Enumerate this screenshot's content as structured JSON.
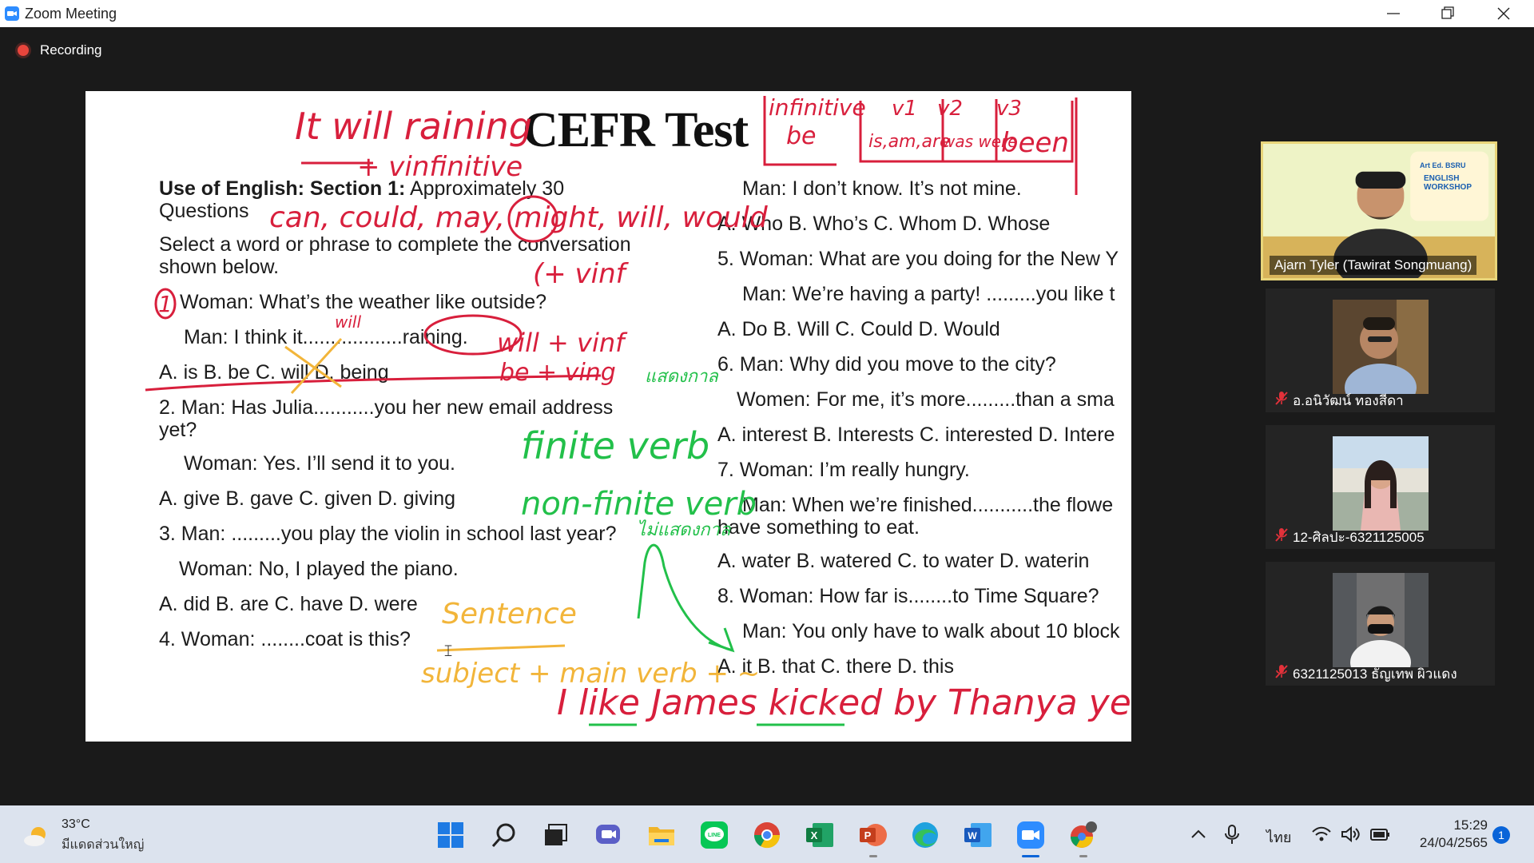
{
  "window": {
    "title": "Zoom Meeting"
  },
  "recording": {
    "label": "Recording"
  },
  "slide": {
    "title": "CEFR Test",
    "left_column": [
      {
        "text": "Use of English: Section 1: Approximately 30",
        "bold_prefix": "Use of English: Section 1:",
        "rest": " Approximately 30"
      },
      {
        "text": "Questions"
      },
      {
        "text": "Select a word or phrase to complete the conversation"
      },
      {
        "text": "shown below."
      },
      {
        "text": "Woman: What’s the weather like outside?"
      },
      {
        "text": "Man: I think it..................raining."
      },
      {
        "text": "A. is  B. be C. will  D. being"
      },
      {
        "text": "2. Man: Has Julia...........you her new email address"
      },
      {
        "text": "yet?"
      },
      {
        "text": "Woman: Yes. I’ll send it to you."
      },
      {
        "text": "A. give  B. gave   C. given   D. giving"
      },
      {
        "text": "3. Man: .........you play the violin in school last year?"
      },
      {
        "text": "Woman: No, I played the piano."
      },
      {
        "text": "A. did  B. are  C. have  D. were"
      },
      {
        "text": "4. Woman: ........coat is this?"
      }
    ],
    "right_column": [
      {
        "text": "Man: I don’t know. It’s not mine."
      },
      {
        "text": "A. Who  B. Who’s   C. Whom  D. Whose"
      },
      {
        "text": "5. Woman: What are you doing for the New Y"
      },
      {
        "text": "Man: We’re having a party! .........you like t"
      },
      {
        "text": "A. Do   B. Will  C. Could   D. Would"
      },
      {
        "text": "6. Man: Why did you move to the city?"
      },
      {
        "text": "Women: For me, it’s more.........than a sma"
      },
      {
        "text": "A. interest   B. Interests  C. interested D. Intere"
      },
      {
        "text": "7. Woman: I’m really hungry."
      },
      {
        "text": "Man: When we’re finished...........the flowe"
      },
      {
        "text": "have something to eat."
      },
      {
        "text": "A. water      B. watered    C. to water  D. waterin"
      },
      {
        "text": "8. Woman: How far is........to Time Square?"
      },
      {
        "text": "Man: You only have to walk about 10 block"
      },
      {
        "text": "A. it     B. that    C. there   D. this"
      }
    ],
    "annotations": {
      "top_left": "It will raining",
      "top_left_sub": "+ vinfinitive",
      "modals": "can, could, may, might, will, would",
      "plus_vinf": "(+ vinf",
      "question_number": "1",
      "above_blank": "will",
      "will_vinf": "will + vinf",
      "be_ving": "be + ving",
      "finite": "finite verb",
      "nonfinite": "non-finite verb",
      "nonfinite_thai": "ไม่แสดงกาล",
      "thai_small": "แสดงกาล",
      "infinitive": "infinitive",
      "be": "be",
      "v1": "v1",
      "v2": "v2",
      "v3": "v3",
      "is_am_are": "is,am,are",
      "was_were": "was were",
      "been": "been",
      "sentence": "Sentence",
      "subject_verb": "subject + main verb + ~",
      "example": "I like James kicked by Thanya yesterday"
    },
    "colors": {
      "red_ink": "#d81f3c",
      "green_ink": "#22c04a",
      "yellow_ink": "#f2b53a"
    }
  },
  "participants": [
    {
      "name": "Ajarn Tyler (Tawirat Songmuang)",
      "speaking": true,
      "banner": "ENGLISH WORKSHOP",
      "banner_sub": "Art Ed. BSRU"
    },
    {
      "name": "อ.อนิวัฒน์ ทองสีดา",
      "muted": true
    },
    {
      "name": "12-ศิลปะ-6321125005",
      "muted": true
    },
    {
      "name": "6321125013 ธัญเทพ ผิวแดง",
      "muted": true
    }
  ],
  "taskbar": {
    "weather": {
      "temp": "33°C",
      "desc": "มีแดดส่วนใหญ่"
    },
    "apps": [
      "start-icon",
      "search-icon",
      "task-view-icon",
      "teams-chat-icon",
      "file-explorer-icon",
      "line-icon",
      "chrome-icon",
      "excel-icon",
      "powerpoint-icon",
      "edge-icon",
      "word-icon",
      "zoom-icon",
      "chrome-profile-icon"
    ],
    "language": "ไทย",
    "time": "15:29",
    "date": "24/04/2565",
    "notifications": "1"
  }
}
